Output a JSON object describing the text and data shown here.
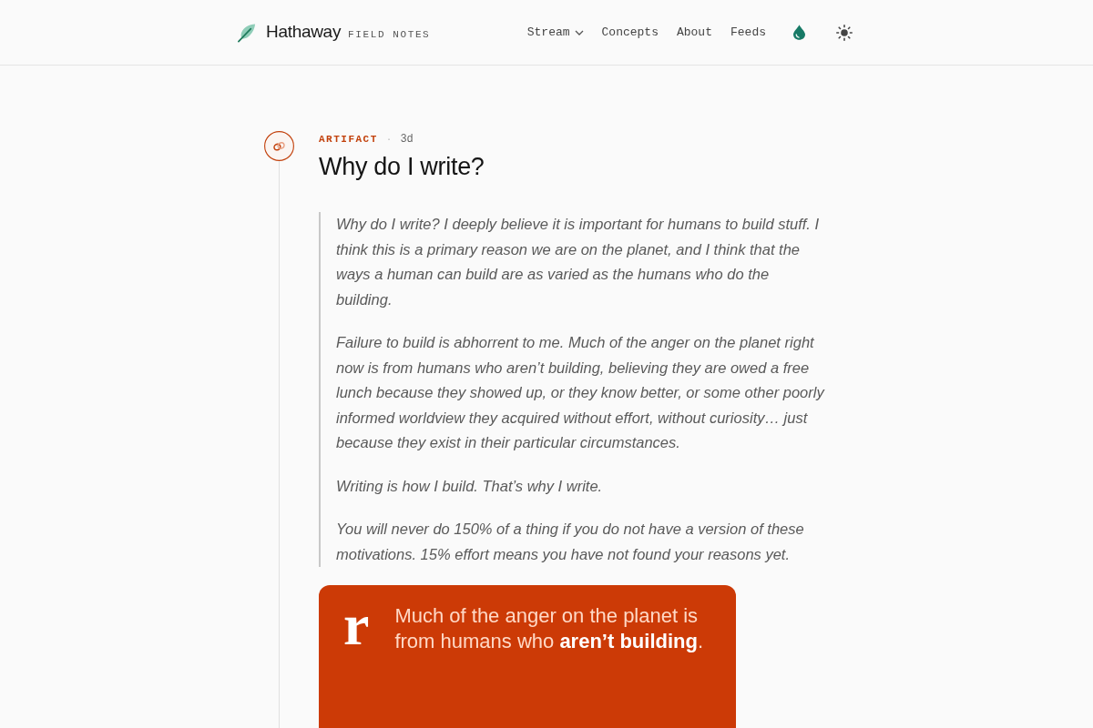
{
  "header": {
    "brand": {
      "name": "Hathaway",
      "tagline": "FIELD NOTES"
    },
    "nav": [
      {
        "label": "Stream",
        "kind": "dropdown"
      },
      {
        "label": "Concepts",
        "kind": "link"
      },
      {
        "label": "About",
        "kind": "link"
      },
      {
        "label": "Feeds",
        "kind": "link"
      }
    ]
  },
  "post": {
    "category": "ARTIFACT",
    "separator": "·",
    "age": "3d",
    "title": "Why do I write?",
    "quote": [
      "Why do I write? I deeply believe it is important for humans to build stuff. I think this is a primary reason we are on the planet, and I think that the ways a human can build are as varied as the humans who do the building.",
      "Failure to build is abhorrent to me. Much of the anger on the planet right now is from humans who aren’t building, believing they are owed a free lunch because they showed up, or they know better, or some other poorly informed worldview they acquired without effort, without curiosity… just because they exist in their particular circumstances.",
      "Writing is how I build. That’s why I write.",
      "You will never do 150% of a thing if you do not have a version of these motivations. 15% effort means you have not found your reasons yet."
    ],
    "card": {
      "glyph": "r",
      "text": "Much of the anger on the planet is from humans who **aren’t building**."
    }
  }
}
